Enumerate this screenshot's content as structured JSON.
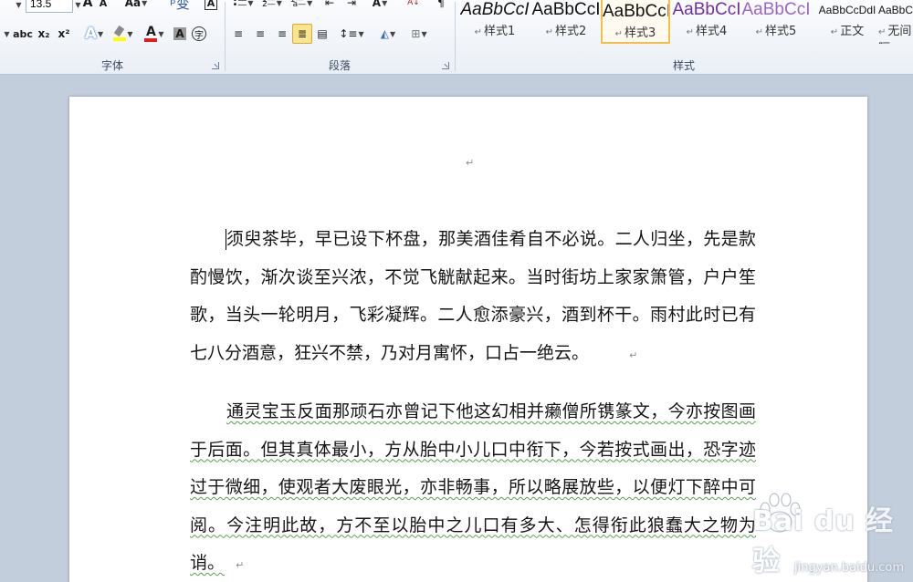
{
  "ribbon": {
    "font_group": {
      "label": "字体",
      "font_size": "13.5",
      "grow_font": "A",
      "shrink_font": "A",
      "change_case": "Aa",
      "strikethrough": "abc",
      "subscript": "x₂",
      "superscript": "x²",
      "text_effect": "A",
      "highlight_color": "#ffff00",
      "font_color": "#e0201c",
      "char_shading": "A",
      "enclose_char": "字"
    },
    "para_group": {
      "label": "段落"
    },
    "styles_group": {
      "label": "样式",
      "items": [
        {
          "sample": "AaBbCcI",
          "name": "样式1"
        },
        {
          "sample": "AaBbCcI",
          "name": "样式2"
        },
        {
          "sample": "AaBbCcI",
          "name": "样式3"
        },
        {
          "sample": "AaBbCcI",
          "name": "样式4"
        },
        {
          "sample": "AaBbCcI",
          "name": "样式5"
        },
        {
          "sample": "AaBbCcDdI",
          "name": "正文"
        },
        {
          "sample": "AaBbCcDd",
          "name": "无间隔"
        }
      ],
      "selected_index": 2,
      "colors": {
        "style4": "#7030a0",
        "style5": "#9a68c8"
      }
    }
  },
  "document": {
    "paragraphs": [
      "须臾茶毕，早已设下杯盘，那美酒佳肴自不必说。二人归坐，先是款酌慢饮，渐次谈至兴浓，不觉飞觥献起来。当时街坊上家家箫管，户户笙歌，当头一轮明月，飞彩凝辉。二人愈添豪兴，酒到杯干。雨村此时已有七八分酒意，狂兴不禁，乃对月寓怀，口占一绝云。",
      "通灵宝玉反面那顽石亦曾记下他这幻相并癞僧所镌篆文，今亦按图画于后面。但其真体最小，方从胎中小儿口中衔下，今若按式画出，恐字迹过于微细，使观者大废眼光，亦非畅事，所以略展放些，以便灯下醉中可阅。今注明此故，方不至以胎中之儿口有多大、怎得衔此狼蠢大之物为诮。"
    ],
    "paragraph_mark": "↵"
  },
  "watermark": {
    "logo": "Bai du 经验",
    "url": "jingyan.baidu.com"
  }
}
